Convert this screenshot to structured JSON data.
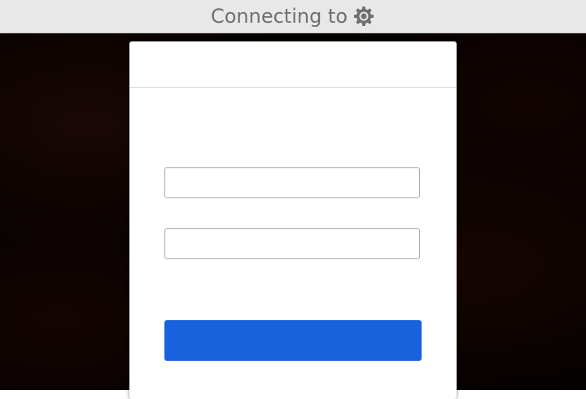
{
  "header": {
    "title": "Connecting to",
    "icon": "gear-icon",
    "text_color": "#6f6f6f",
    "background": "#e8e8e8"
  },
  "dialog": {
    "title": "",
    "username": {
      "value": "",
      "placeholder": ""
    },
    "password": {
      "value": "",
      "placeholder": ""
    },
    "submit_label": "",
    "submit_color": "#1862dd"
  }
}
